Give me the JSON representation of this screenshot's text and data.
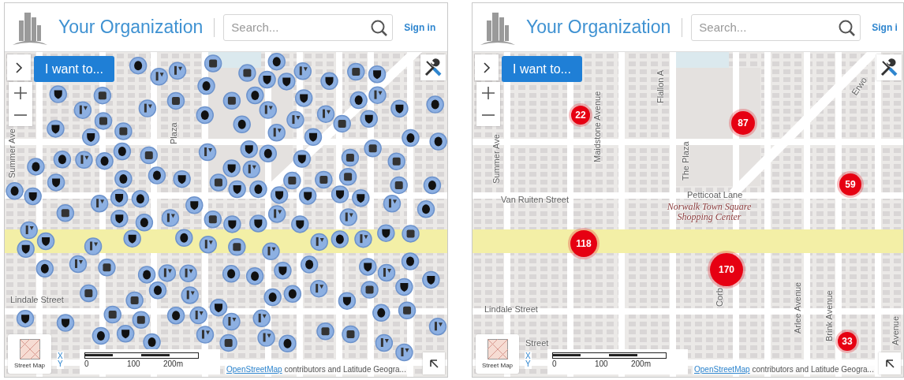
{
  "panels": [
    {
      "header": {
        "org_name": "Your Organization",
        "search_placeholder": "Search...",
        "sign_in": "Sign in"
      },
      "menu_button": "I want to...",
      "map": {
        "kind": "markers",
        "street_labels": [
          {
            "text": "Summer Ave",
            "kind": "vertical"
          },
          {
            "text": "Plaza",
            "kind": "vertical"
          },
          {
            "text": "Lindale Street",
            "kind": "horizontal"
          }
        ]
      },
      "basemap": {
        "label": "Street Map"
      },
      "xy": {
        "x": "X",
        "y": "Y"
      },
      "scale": {
        "ticks": [
          "0",
          "100",
          "200m"
        ]
      },
      "attribution": {
        "link": "OpenStreetMap",
        "text": "contributors and Latitude Geogra..."
      }
    },
    {
      "header": {
        "org_name": "Your Organization",
        "search_placeholder": "Search...",
        "sign_in": "Sign i"
      },
      "menu_button": "I want to...",
      "map": {
        "kind": "clusters",
        "street_labels": [
          {
            "text": "Summer Ave",
            "kind": "vertical"
          },
          {
            "text": "Maidstone Avenue",
            "kind": "vertical"
          },
          {
            "text": "Flallon A",
            "kind": "vertical"
          },
          {
            "text": "The Plaza",
            "kind": "vertical"
          },
          {
            "text": "Petticoat Lane",
            "kind": "horizontal"
          },
          {
            "text": "Van Ruiten Street",
            "kind": "horizontal"
          },
          {
            "text": "Norwalk Town Square Shopping Center",
            "kind": "place"
          },
          {
            "text": "Lindale Street",
            "kind": "horizontal"
          },
          {
            "text": "Corb",
            "kind": "vertical"
          },
          {
            "text": "Arlee Avenue",
            "kind": "vertical"
          },
          {
            "text": "Brink Avenue",
            "kind": "vertical"
          },
          {
            "text": "Street",
            "kind": "horizontal"
          },
          {
            "text": "Erwo",
            "kind": "diagonal"
          },
          {
            "text": "Avenue",
            "kind": "vertical"
          }
        ],
        "clusters": [
          {
            "count": "22"
          },
          {
            "count": "87"
          },
          {
            "count": "59"
          },
          {
            "count": "118"
          },
          {
            "count": "170"
          },
          {
            "count": "33"
          }
        ]
      },
      "basemap": {
        "label": "Street Map"
      },
      "xy": {
        "x": "X",
        "y": "Y"
      },
      "scale": {
        "ticks": [
          "0",
          "100",
          "200m"
        ]
      },
      "attribution": {
        "link": "OpenStreetMap",
        "text": "contributors and Latitude Geogra..."
      }
    }
  ]
}
